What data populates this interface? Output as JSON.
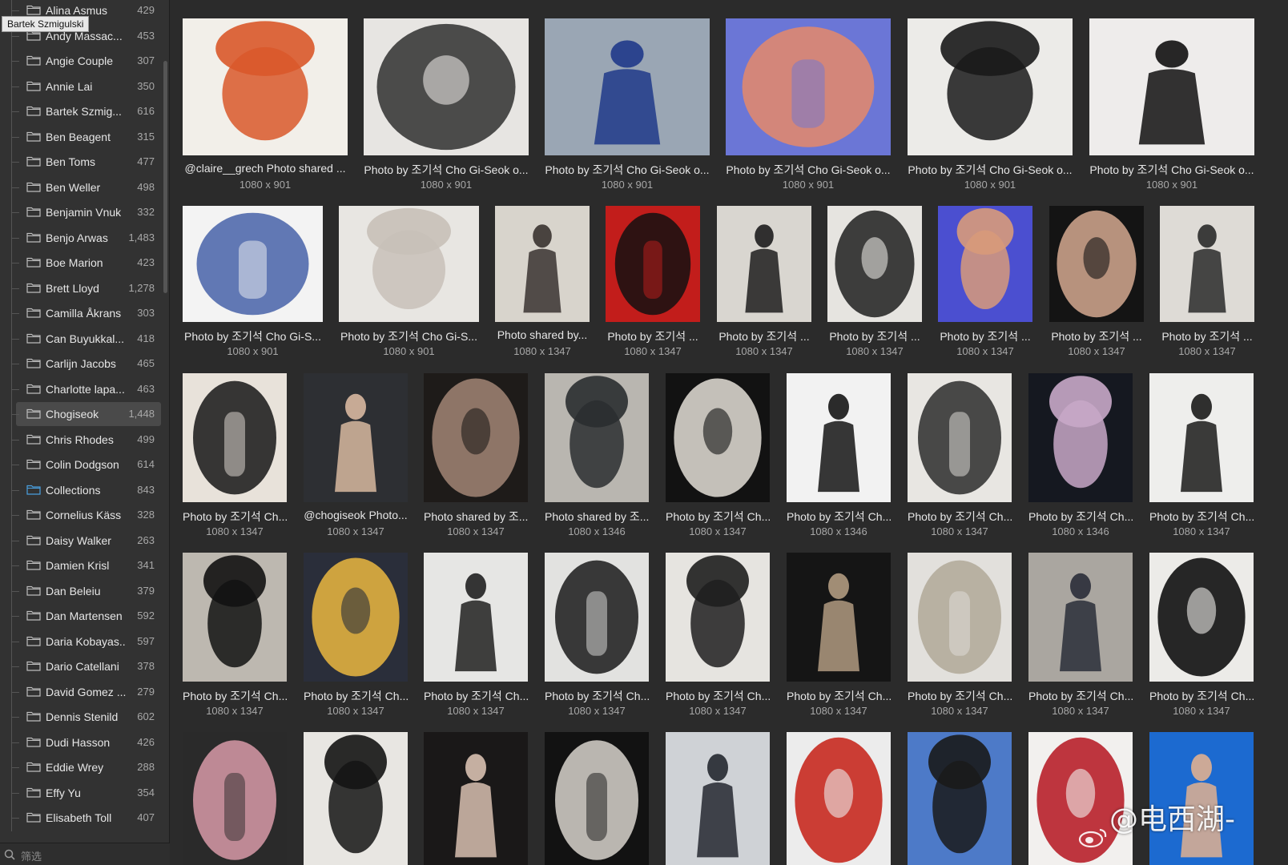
{
  "tooltip": "Bartek Szmigulski",
  "filter": {
    "placeholder": "筛选"
  },
  "folders": [
    {
      "name": "Alina Asmus",
      "count": "429"
    },
    {
      "name": "Andy Massac...",
      "count": "453"
    },
    {
      "name": "Angie Couple",
      "count": "307"
    },
    {
      "name": "Annie Lai",
      "count": "350"
    },
    {
      "name": "Bartek Szmig...",
      "count": "616"
    },
    {
      "name": "Ben Beagent",
      "count": "315"
    },
    {
      "name": "Ben Toms",
      "count": "477"
    },
    {
      "name": "Ben Weller",
      "count": "498"
    },
    {
      "name": "Benjamin Vnuk",
      "count": "332"
    },
    {
      "name": "Benjo Arwas",
      "count": "1,483"
    },
    {
      "name": "Boe Marion",
      "count": "423"
    },
    {
      "name": "Brett Lloyd",
      "count": "1,278"
    },
    {
      "name": "Camilla Åkrans",
      "count": "303"
    },
    {
      "name": "Can Buyukkal...",
      "count": "418"
    },
    {
      "name": "Carlijn Jacobs",
      "count": "465"
    },
    {
      "name": "Charlotte lapa...",
      "count": "463"
    },
    {
      "name": "Chogiseok",
      "count": "1,448",
      "selected": true
    },
    {
      "name": "Chris Rhodes",
      "count": "499"
    },
    {
      "name": "Colin Dodgson",
      "count": "614"
    },
    {
      "name": "Collections",
      "count": "843",
      "color": "#4aa0e0"
    },
    {
      "name": "Cornelius Käss",
      "count": "328"
    },
    {
      "name": "Daisy Walker",
      "count": "263"
    },
    {
      "name": "Damien Krisl",
      "count": "341"
    },
    {
      "name": "Dan Beleiu",
      "count": "379"
    },
    {
      "name": "Dan Martensen",
      "count": "592"
    },
    {
      "name": "Daria Kobayas...",
      "count": "597"
    },
    {
      "name": "Dario Catellani",
      "count": "378"
    },
    {
      "name": "David Gomez ...",
      "count": "279"
    },
    {
      "name": "Dennis Stenild",
      "count": "602"
    },
    {
      "name": "Dudi Hasson",
      "count": "426"
    },
    {
      "name": "Eddie Wrey",
      "count": "288"
    },
    {
      "name": "Effy Yu",
      "count": "354"
    },
    {
      "name": "Elisabeth Toll",
      "count": "407"
    }
  ],
  "grid": {
    "rows": [
      {
        "items": [
          {
            "title": "@claire__grech Photo shared ...",
            "dims": "1080 x 901",
            "bg": "#f2efe9",
            "fg": "#d9582a"
          },
          {
            "title": "Photo by 조기석 Cho Gi-Seok o...",
            "dims": "1080 x 901",
            "bg": "#e7e5e2",
            "fg": "#3a3a3a"
          },
          {
            "title": "Photo by 조기석 Cho Gi-Seok o...",
            "dims": "1080 x 901",
            "bg": "#9aa6b4",
            "fg": "#203a8a"
          },
          {
            "title": "Photo by 조기석 Cho Gi-Seok o...",
            "dims": "1080 x 901",
            "bg": "#6b76d6",
            "fg": "#e58a6a"
          },
          {
            "title": "Photo by 조기석 Cho Gi-Seok o...",
            "dims": "1080 x 901",
            "bg": "#ecebe8",
            "fg": "#1a1a1a"
          },
          {
            "title": "Photo by 조기석 Cho Gi-Seok o...",
            "dims": "1080 x 901",
            "bg": "#eeeceb",
            "fg": "#111111"
          }
        ]
      },
      {
        "items": [
          {
            "title": "Photo by 조기석 Cho Gi-S...",
            "dims": "1080 x 901",
            "bg": "#f3f3f3",
            "fg": "#4662a8"
          },
          {
            "title": "Photo by 조기석 Cho Gi-S...",
            "dims": "1080 x 901",
            "bg": "#e8e6e2",
            "fg": "#c8c0b8"
          },
          {
            "title": "Photo shared by...",
            "dims": "1080 x 1347",
            "bg": "#d8d4cc",
            "fg": "#3a3330"
          },
          {
            "title": "Photo by 조기석 ...",
            "dims": "1080 x 1347",
            "bg": "#c21d1b",
            "fg": "#141010"
          },
          {
            "title": "Photo by 조기석 ...",
            "dims": "1080 x 1347",
            "bg": "#d9d6d0",
            "fg": "#1d1d1d"
          },
          {
            "title": "Photo by 조기석 ...",
            "dims": "1080 x 1347",
            "bg": "#e6e4e0",
            "fg": "#2a2a2a"
          },
          {
            "title": "Photo by 조기석 ...",
            "dims": "1080 x 1347",
            "bg": "#4b4fd0",
            "fg": "#d89a7a"
          },
          {
            "title": "Photo by 조기석 ...",
            "dims": "1080 x 1347",
            "bg": "#141414",
            "fg": "#c9a088"
          },
          {
            "title": "Photo by 조기석 ...",
            "dims": "1080 x 1347",
            "bg": "#dedbd6",
            "fg": "#2a2a2a"
          }
        ]
      },
      {
        "items": [
          {
            "title": "Photo by 조기석 Ch...",
            "dims": "1080 x 1347",
            "bg": "#e8e2da",
            "fg": "#161616"
          },
          {
            "title": "@chogiseok Photo...",
            "dims": "1080 x 1347",
            "bg": "#2d2f33",
            "fg": "#d8b8a0"
          },
          {
            "title": "Photo shared by 조...",
            "dims": "1080 x 1347",
            "bg": "#1e1b19",
            "fg": "#9a8070"
          },
          {
            "title": "Photo shared by 조...",
            "dims": "1080 x 1346",
            "bg": "#b9b6b0",
            "fg": "#2a2e30"
          },
          {
            "title": "Photo by 조기석 Ch...",
            "dims": "1080 x 1347",
            "bg": "#121212",
            "fg": "#d8d4cc"
          },
          {
            "title": "Photo by 조기석 Ch...",
            "dims": "1080 x 1346",
            "bg": "#f2f2f2",
            "fg": "#151515"
          },
          {
            "title": "Photo by 조기석 Ch...",
            "dims": "1080 x 1347",
            "bg": "#e8e6e2",
            "fg": "#2b2b2b"
          },
          {
            "title": "Photo by 조기석 Ch...",
            "dims": "1080 x 1346",
            "bg": "#151820",
            "fg": "#c8a8c8"
          },
          {
            "title": "Photo by 조기석 Ch...",
            "dims": "1080 x 1347",
            "bg": "#eeeeec",
            "fg": "#1a1a1a"
          }
        ]
      },
      {
        "items": [
          {
            "title": "Photo by 조기석 Ch...",
            "dims": "1080 x 1347",
            "bg": "#bdb8b0",
            "fg": "#121212"
          },
          {
            "title": "Photo by 조기석 Ch...",
            "dims": "1080 x 1347",
            "bg": "#2a2e3a",
            "fg": "#e0b040"
          },
          {
            "title": "Photo by 조기석 Ch...",
            "dims": "1080 x 1347",
            "bg": "#e6e6e4",
            "fg": "#202020"
          },
          {
            "title": "Photo by 조기석 Ch...",
            "dims": "1080 x 1347",
            "bg": "#e2e2e0",
            "fg": "#1a1a1a"
          },
          {
            "title": "Photo by 조기석 Ch...",
            "dims": "1080 x 1347",
            "bg": "#e6e4e0",
            "fg": "#1e1e1e"
          },
          {
            "title": "Photo by 조기석 Ch...",
            "dims": "1080 x 1347",
            "bg": "#151515",
            "fg": "#b09a80"
          },
          {
            "title": "Photo by 조기석 Ch...",
            "dims": "1080 x 1347",
            "bg": "#e2e0dc",
            "fg": "#b0a898"
          },
          {
            "title": "Photo by 조기석 Ch...",
            "dims": "1080 x 1347",
            "bg": "#aaa6a0",
            "fg": "#2a2e38"
          },
          {
            "title": "Photo by 조기석 Ch...",
            "dims": "1080 x 1347",
            "bg": "#ecebe8",
            "fg": "#111111"
          }
        ]
      },
      {
        "items": [
          {
            "title": "",
            "dims": "",
            "bg": "#2a2a2a",
            "fg": "#d89aa8"
          },
          {
            "title": "",
            "dims": "",
            "bg": "#e8e6e2",
            "fg": "#141414"
          },
          {
            "title": "",
            "dims": "",
            "bg": "#1a1818",
            "fg": "#d8c0b0"
          },
          {
            "title": "",
            "dims": "",
            "bg": "#121212",
            "fg": "#d8d4cc"
          },
          {
            "title": "",
            "dims": "",
            "bg": "#cfd2d6",
            "fg": "#242830"
          },
          {
            "title": "",
            "dims": "",
            "bg": "#ececec",
            "fg": "#c82a20"
          },
          {
            "title": "",
            "dims": "",
            "bg": "#4d7ac8",
            "fg": "#1a1a1a"
          },
          {
            "title": "",
            "dims": "",
            "bg": "#f2f0ee",
            "fg": "#b8202a"
          },
          {
            "title": "",
            "dims": "",
            "bg": "#1c6ad0",
            "fg": "#e0b090"
          }
        ]
      }
    ]
  },
  "watermark": "@电西湖-"
}
